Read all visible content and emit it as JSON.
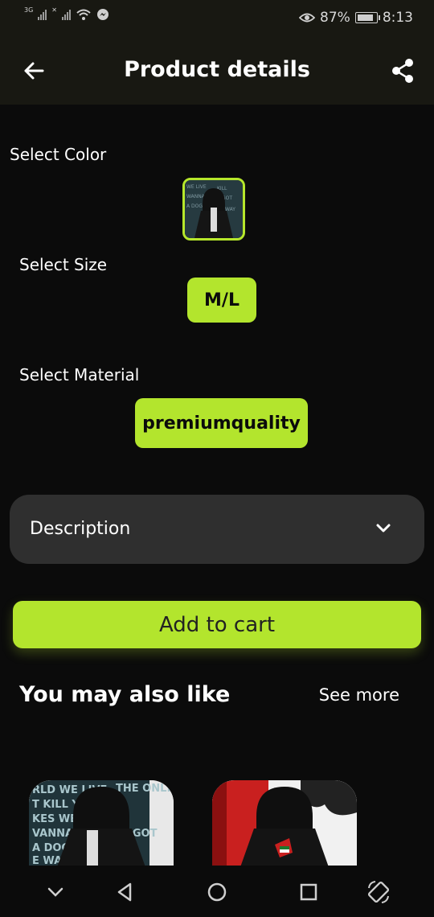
{
  "status_bar": {
    "network_label": "3G",
    "battery_percent": "87%",
    "time": "8:13"
  },
  "app_bar": {
    "title": "Product details",
    "back_icon": "arrow-left-icon",
    "share_icon": "share-icon"
  },
  "color_section": {
    "label": "Select Color",
    "selected_color_index": 0
  },
  "size_section": {
    "label": "Select Size",
    "selected_value": "M/L"
  },
  "material_section": {
    "label": "Select Material",
    "selected_value": "premiumquality"
  },
  "description": {
    "label": "Description",
    "chevron_icon": "chevron-down-icon"
  },
  "add_to_cart": {
    "label": "Add to cart"
  },
  "also_like": {
    "title": "You may also like",
    "see_more": "See more",
    "items": [
      {
        "thumbnail": "joker-hoodie-product-image"
      },
      {
        "thumbnail": "graphic-hoodie-product-image"
      }
    ]
  },
  "nav_bar": {
    "buttons": [
      "chevron-down-icon",
      "back-triangle-icon",
      "home-circle-icon",
      "recents-square-icon",
      "rotate-icon"
    ]
  },
  "colors": {
    "accent": "#b3e52d",
    "background": "#0b0b0b",
    "surface": "#2f2f2f",
    "app_bar": "#181812"
  }
}
